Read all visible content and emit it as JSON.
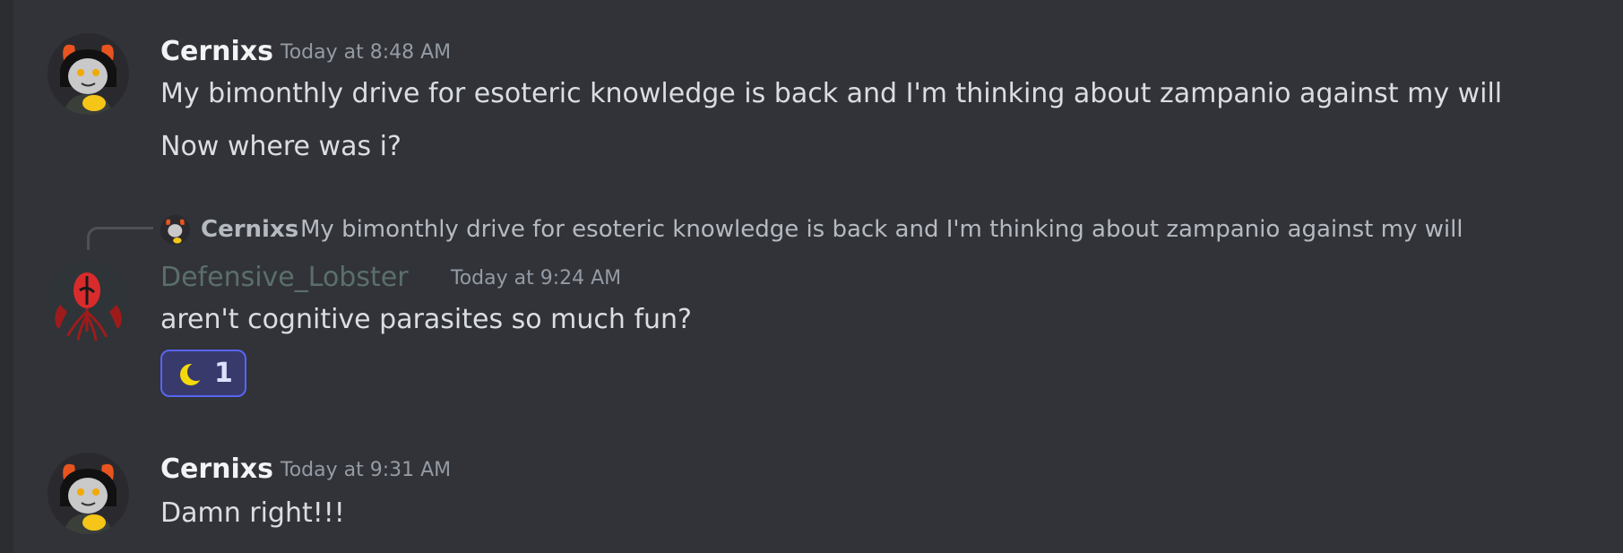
{
  "messages": [
    {
      "author": "Cernixs",
      "timestamp": "Today at 8:48 AM",
      "lines": [
        "My bimonthly drive for esoteric knowledge is back and I'm thinking about zampanio against my will",
        "Now where was i?"
      ]
    },
    {
      "reply_to": {
        "author": "Cernixs",
        "text": "My bimonthly drive for esoteric knowledge is back and I'm thinking about zampanio against my will"
      },
      "author": "Defensive_Lobster",
      "author_color": "#5b6f6a",
      "timestamp": "Today at 9:24 AM",
      "lines": [
        "aren't cognitive parasites so much fun?"
      ],
      "reaction": {
        "emoji": "crescent-moon-icon",
        "count": "1"
      }
    },
    {
      "author": "Cernixs",
      "timestamp": "Today at 9:31 AM",
      "lines": [
        "Damn right!!!"
      ]
    }
  ],
  "colors": {
    "background": "#313338",
    "accent": "#5865f2",
    "moon": "#f5d90a"
  }
}
